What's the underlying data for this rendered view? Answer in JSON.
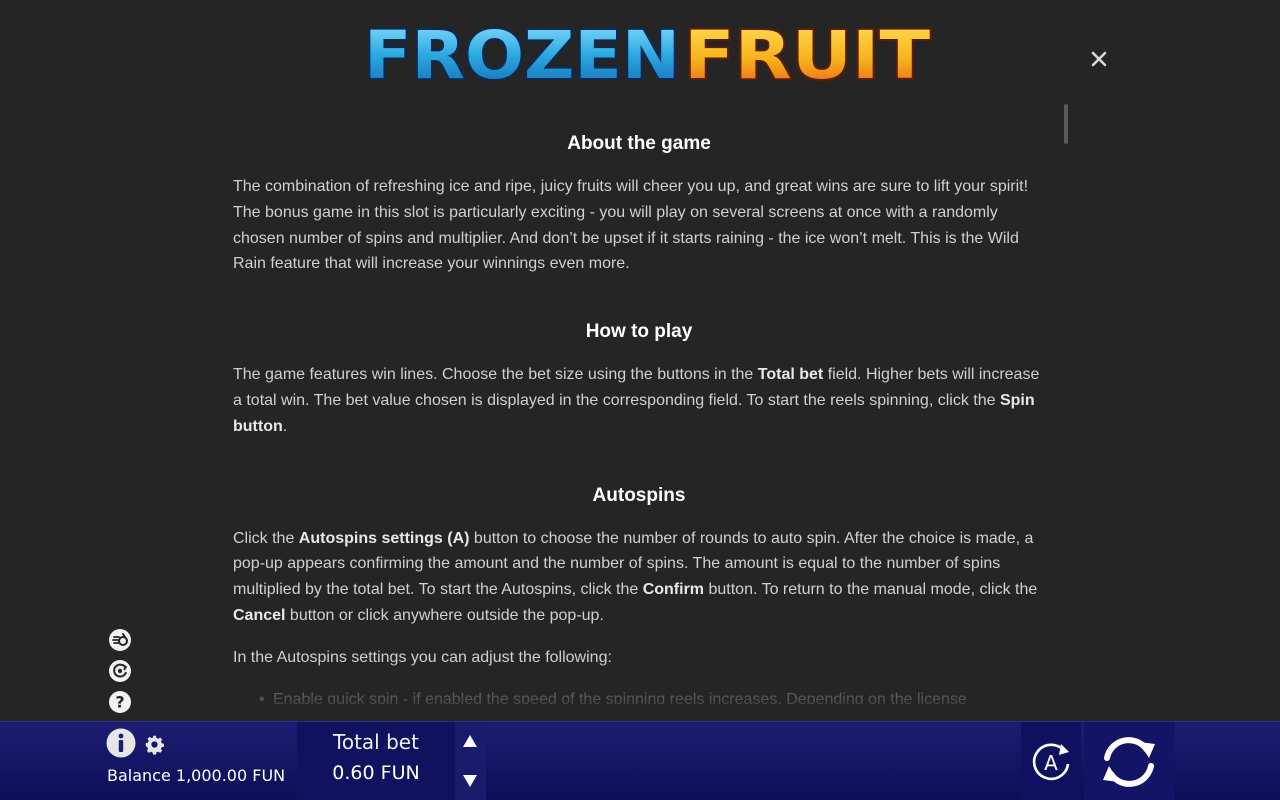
{
  "logo": {
    "text_left": "FROZEN",
    "text_right": "FRUIT",
    "colors": {
      "frozen": "#2aa8e0",
      "fruit": "#f7b21a",
      "outline": "#0b2a55"
    }
  },
  "close": {
    "icon": "close-icon"
  },
  "sections": {
    "about": {
      "title": "About the game",
      "text": "The combination of refreshing ice and ripe, juicy fruits will cheer you up, and great wins are sure to lift your spirit! The bonus game in this slot is particularly exciting - you will play on several screens at once with a randomly chosen number of spins and multiplier. And don’t be upset if it starts raining - the ice won’t melt. This is the Wild Rain feature that will increase your winnings even more."
    },
    "how": {
      "title": "How to play",
      "t1": "The game features win lines. Choose the bet size using the buttons in the ",
      "b1": "Total bet",
      "t2": " field. Higher bets will increase a total win. The bet value chosen is displayed in the corresponding field. To start the reels spinning, click the ",
      "b2": "Spin button",
      "t3": "."
    },
    "autospins": {
      "title": "Autospins",
      "t1": "Click the ",
      "b1": "Autospins settings (A)",
      "t2": " button to choose the number of rounds to auto spin. After the choice is made, a pop-up appears confirming the amount and the number of spins. The amount is equal to the number of spins multiplied by the total bet. To start the Autospins, click the ",
      "b2": "Confirm",
      "t3": " button. To return to the manual mode, click the ",
      "b3": "Cancel",
      "t4": " button or click anywhere outside the pop-up.",
      "adjust": "In the Autospins settings you can adjust the following:",
      "items": [
        "Enable quick spin - if enabled the speed of the spinning reels increases. Depending on the license"
      ]
    }
  },
  "side_icons": [
    "turbo-icon",
    "autoplay-settings-icon",
    "help-icon"
  ],
  "bottom": {
    "balance_label": "Balance",
    "balance_value": "1,000.00 FUN",
    "bet_label": "Total bet",
    "bet_value": "0.60 FUN",
    "auto_label": "A"
  },
  "colors": {
    "bar_top": "#1c1d72",
    "bar_bottom": "#0d0e58",
    "background": "#252525"
  }
}
